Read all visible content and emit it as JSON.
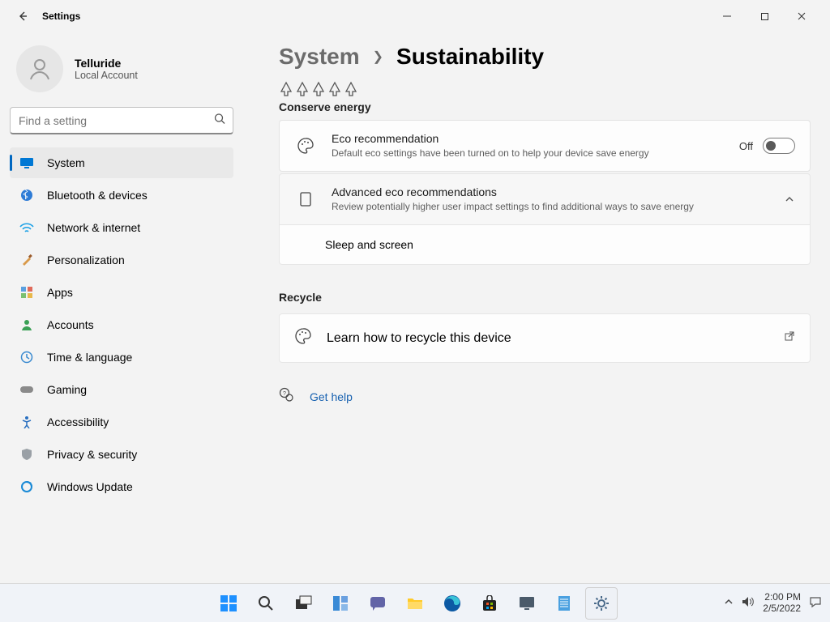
{
  "window": {
    "title": "Settings"
  },
  "account": {
    "name": "Telluride",
    "type": "Local Account"
  },
  "search": {
    "placeholder": "Find a setting"
  },
  "nav": {
    "items": [
      {
        "label": "System"
      },
      {
        "label": "Bluetooth & devices"
      },
      {
        "label": "Network & internet"
      },
      {
        "label": "Personalization"
      },
      {
        "label": "Apps"
      },
      {
        "label": "Accounts"
      },
      {
        "label": "Time & language"
      },
      {
        "label": "Gaming"
      },
      {
        "label": "Accessibility"
      },
      {
        "label": "Privacy & security"
      },
      {
        "label": "Windows Update"
      }
    ]
  },
  "breadcrumb": {
    "parent": "System",
    "current": "Sustainability"
  },
  "sections": {
    "conserve": {
      "heading": "Conserve energy",
      "eco": {
        "title": "Eco recommendation",
        "desc": "Default eco settings have been turned on to help your device save energy",
        "state_label": "Off",
        "state": "off"
      },
      "advanced": {
        "title": "Advanced eco recommendations",
        "desc": "Review potentially higher user impact settings to find additional ways to save energy",
        "expanded": true,
        "sub": {
          "label": "Sleep and screen"
        }
      }
    },
    "recycle": {
      "heading": "Recycle",
      "link": {
        "label": "Learn how to recycle this device"
      }
    }
  },
  "help": {
    "label": "Get help"
  },
  "tray": {
    "time": "2:00 PM",
    "date": "2/5/2022"
  }
}
